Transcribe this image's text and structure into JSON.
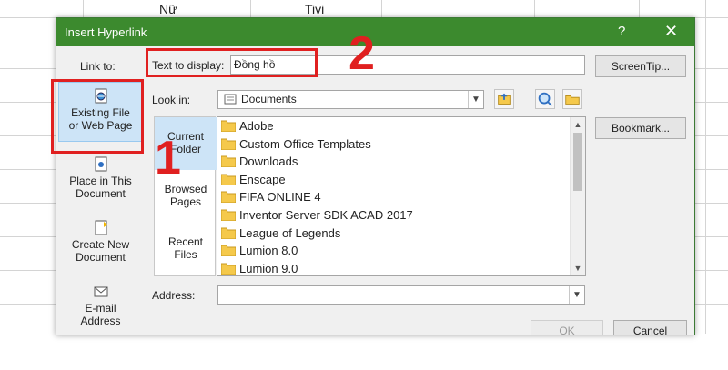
{
  "sheet": {
    "cell_nu": "Nữ",
    "cell_tivi": "Tivi"
  },
  "dialog": {
    "title": "Insert Hyperlink",
    "help": "?",
    "close": "✕",
    "link_to_label": "Link to:",
    "link_to": [
      {
        "line1": "Existing File",
        "line2": "or Web Page",
        "icon": "globe-file-icon",
        "selected": true
      },
      {
        "line1": "Place in This",
        "line2": "Document",
        "icon": "document-place-icon",
        "selected": false
      },
      {
        "line1": "Create New",
        "line2": "Document",
        "icon": "new-document-icon",
        "selected": false
      },
      {
        "line1": "E-mail",
        "line2": "Address",
        "icon": "email-icon",
        "selected": false
      }
    ],
    "text_to_display_label": "Text to display:",
    "text_to_display_value": "Đồng hồ",
    "screentip_button": "ScreenTip...",
    "look_in_label": "Look in:",
    "look_in_value": "Documents",
    "places": [
      {
        "line1": "Current",
        "line2": "Folder",
        "selected": true
      },
      {
        "line1": "Browsed",
        "line2": "Pages",
        "selected": false
      },
      {
        "line1": "Recent",
        "line2": "Files",
        "selected": false
      }
    ],
    "files": [
      "Adobe",
      "Custom Office Templates",
      "Downloads",
      "Enscape",
      "FIFA ONLINE 4",
      "Inventor Server SDK ACAD 2017",
      "League of Legends",
      "Lumion 8.0",
      "Lumion 9.0"
    ],
    "bookmark_button": "Bookmark...",
    "address_label": "Address:",
    "address_value": "",
    "ok_button": "OK",
    "cancel_button": "Cancel"
  },
  "annotations": {
    "one": "1",
    "two": "2"
  },
  "colors": {
    "titlebar": "#3c8a2e",
    "annotation": "#e02020",
    "selection": "#cde4f7",
    "folder": "#f5c94b"
  }
}
